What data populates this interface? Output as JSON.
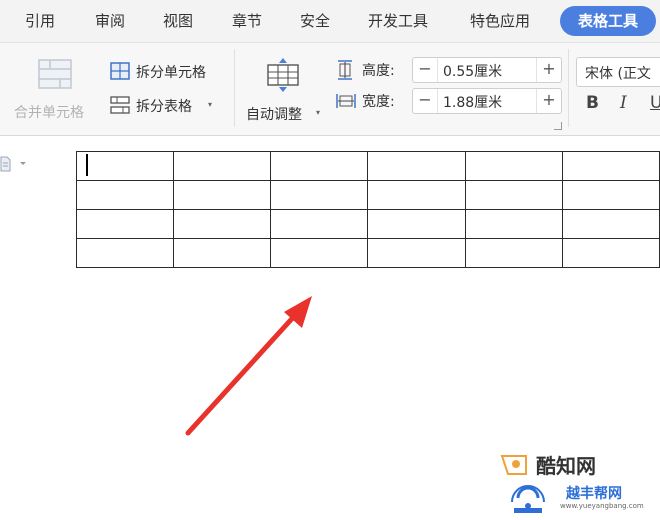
{
  "tabs": [
    {
      "label": "引用"
    },
    {
      "label": "审阅"
    },
    {
      "label": "视图"
    },
    {
      "label": "章节"
    },
    {
      "label": "安全"
    },
    {
      "label": "开发工具"
    },
    {
      "label": "特色应用"
    },
    {
      "label": "表格工具",
      "active": true
    }
  ],
  "ribbon": {
    "merge_cells": "合并单元格",
    "split_cells": "拆分单元格",
    "split_table": "拆分表格",
    "auto_fit": "自动调整",
    "height_label": "高度:",
    "height_value": "0.55厘米",
    "width_label": "宽度:",
    "width_value": "1.88厘米",
    "minus": "−",
    "plus": "+",
    "font_name": "宋体 (正文",
    "bold": "B",
    "italic": "I",
    "underline": "U"
  },
  "document": {
    "table": {
      "rows": 4,
      "cols": 6
    }
  },
  "watermark": {
    "brand": "酷知网",
    "brand2": "越丰帮网",
    "url": "www.yueyangbang.com"
  },
  "colors": {
    "active_tab": "#4a7fe0",
    "arrow": "#e8322b",
    "table_border": "#2b2b2b"
  }
}
